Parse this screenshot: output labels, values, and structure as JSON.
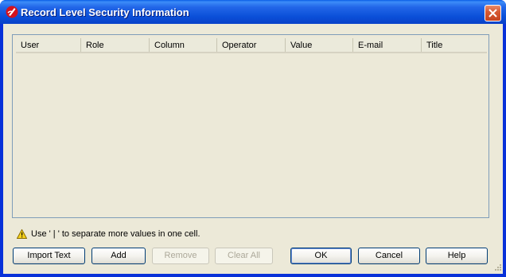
{
  "window": {
    "title": "Record Level Security Information",
    "icon": "app-logo-icon",
    "close_icon": "close-icon"
  },
  "table": {
    "columns": [
      "User",
      "Role",
      "Column",
      "Operator",
      "Value",
      "E-mail",
      "Title"
    ],
    "rows": []
  },
  "hint": {
    "icon": "warning-icon",
    "text": "Use ' | ' to separate more values in one cell."
  },
  "buttons": {
    "import_text": "Import Text",
    "add": "Add",
    "remove": "Remove",
    "clear_all": "Clear All",
    "ok": "OK",
    "cancel": "Cancel",
    "help": "Help"
  },
  "colors": {
    "titlebar": "#0a4fd8",
    "dialog_background": "#ece9d8",
    "table_border": "#7f9db9",
    "close_button": "#d75a34"
  }
}
